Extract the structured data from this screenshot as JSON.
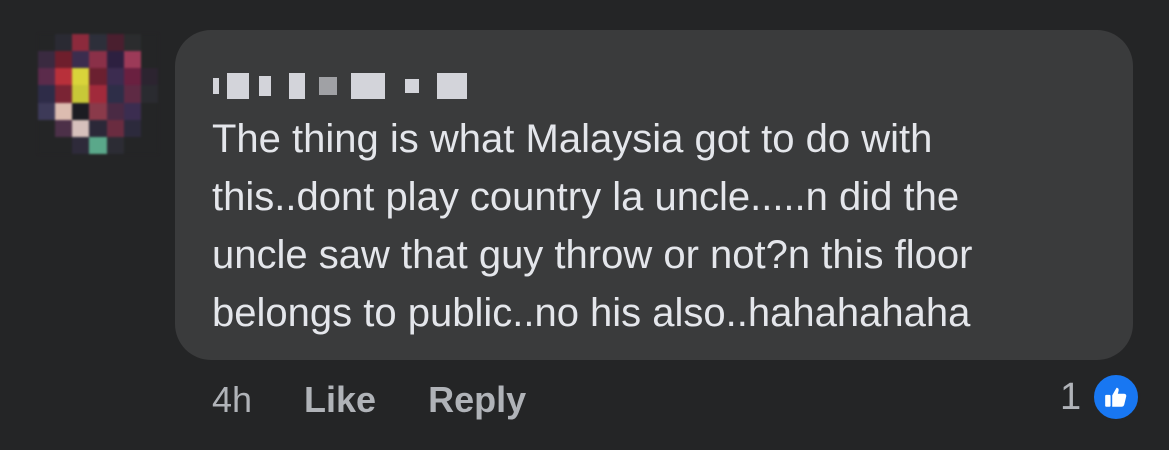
{
  "comment": {
    "text": "The thing is what Malaysia got to do with\nthis..dont play country la uncle.....n did the\nuncle saw that guy throw or not?n this floor\nbelongs to public..no his also..hahahahaha"
  },
  "actions": {
    "time": "4h",
    "like_label": "Like",
    "reply_label": "Reply"
  },
  "reactions": {
    "count": "1",
    "icon": "thumbs-up-icon",
    "badge_color": "#1877f2"
  },
  "colors": {
    "background": "#242526",
    "bubble": "#3a3b3c",
    "text": "#e4e6eb",
    "secondary_text": "#b0b3b8"
  }
}
